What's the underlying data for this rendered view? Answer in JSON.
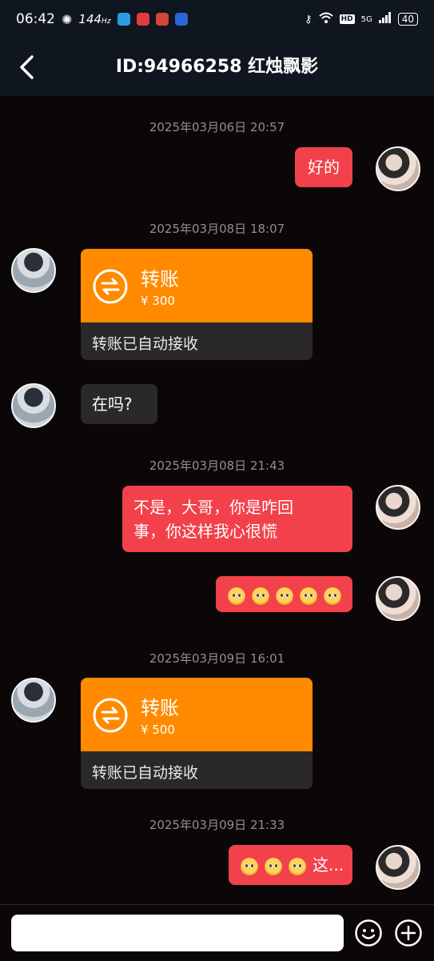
{
  "status_bar": {
    "time": "06:42",
    "refresh_rate": "144",
    "refresh_unit": "Hz",
    "network": "5G",
    "hd": "HD",
    "battery": "40"
  },
  "header": {
    "title": "ID:94966258 红烛飘影"
  },
  "messages": {
    "ts1": "2025年03月06日 20:57",
    "m1": "好的",
    "ts2": "2025年03月08日 18:07",
    "t1_title": "转账",
    "t1_amount": "¥ 300",
    "t1_status": "转账已自动接收",
    "m2": "在吗?",
    "ts3": "2025年03月08日 21:43",
    "m3_line1": "不是，大哥，你是咋回",
    "m3_line2": "事，你这样我心很慌",
    "ts4": "2025年03月09日 16:01",
    "t2_title": "转账",
    "t2_amount": "¥ 500",
    "t2_status": "转账已自动接收",
    "ts5": "2025年03月09日 21:33",
    "m5_text": "这..."
  },
  "emoji_name": "pleading-face",
  "colors": {
    "outgoing_bubble": "#f2414a",
    "incoming_bubble": "#2a2829",
    "transfer_orange": "#ff8a00",
    "background": "#0b0709",
    "timestamp": "#8e8e92"
  }
}
